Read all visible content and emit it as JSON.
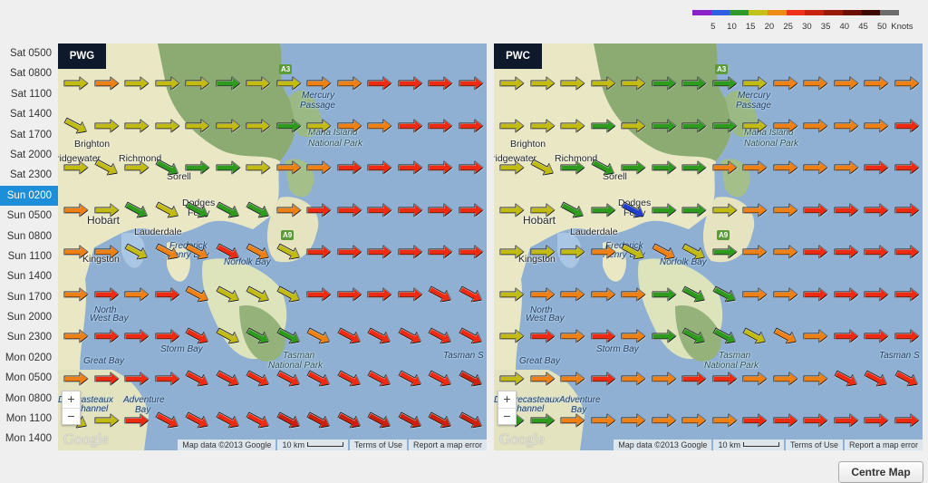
{
  "legend": {
    "colors": [
      "#8b1fc9",
      "#2f5fe0",
      "#2f9a2a",
      "#c4c21a",
      "#ee8a16",
      "#f0301a",
      "#c9220e",
      "#9a1a08",
      "#6e0d04",
      "#3e0602",
      "#6b6b6b"
    ],
    "labels": [
      "5",
      "10",
      "15",
      "20",
      "25",
      "30",
      "35",
      "40",
      "45",
      "50"
    ],
    "units": "Knots"
  },
  "times": {
    "items": [
      "Sat 0500",
      "Sat 0800",
      "Sat 1100",
      "Sat 1400",
      "Sat 1700",
      "Sat 2000",
      "Sat 2300",
      "Sun 0200",
      "Sun 0500",
      "Sun 0800",
      "Sun 1100",
      "Sun 1400",
      "Sun 1700",
      "Sun 2000",
      "Sun 2300",
      "Mon 0200",
      "Mon 0500",
      "Mon 0800",
      "Mon 1100",
      "Mon 1400"
    ],
    "selected_index": 7
  },
  "maps": [
    {
      "label": "PWG",
      "arrow_rows": [
        [
          "Y",
          "O",
          "Y",
          "Y",
          "Y",
          "G",
          "Y",
          "Y",
          "O",
          "O",
          "R",
          "R",
          "R",
          "R"
        ],
        [
          "Y",
          "Y",
          "Y",
          "Y",
          "Y",
          "Y",
          "Y",
          "G",
          "Y",
          "O",
          "O",
          "R",
          "R",
          "R"
        ],
        [
          "Y",
          "Y",
          "Y",
          "G",
          "G",
          "G",
          "Y",
          "O",
          "O",
          "R",
          "R",
          "R",
          "R",
          "R"
        ],
        [
          "O",
          "Y",
          "G",
          "Y",
          "G",
          "G",
          "G",
          "O",
          "R",
          "R",
          "R",
          "R",
          "R",
          "R"
        ],
        [
          "O",
          "O",
          "Y",
          "O",
          "O",
          "R",
          "O",
          "Y",
          "R",
          "R",
          "R",
          "R",
          "R",
          "R"
        ],
        [
          "O",
          "R",
          "O",
          "R",
          "O",
          "Y",
          "Y",
          "Y",
          "R",
          "R",
          "R",
          "R",
          "R",
          "R"
        ],
        [
          "O",
          "R",
          "R",
          "R",
          "R",
          "Y",
          "G",
          "G",
          "O",
          "R",
          "R",
          "R",
          "R",
          "R"
        ],
        [
          "O",
          "R",
          "R",
          "R",
          "R",
          "R",
          "R",
          "R",
          "R",
          "R",
          "R",
          "R",
          "R",
          "D"
        ],
        [
          "Y",
          "Y",
          "R",
          "R",
          "R",
          "R",
          "R",
          "D",
          "D",
          "D",
          "D",
          "D",
          "D",
          "D"
        ]
      ],
      "arrow_dirs": [
        [
          "e",
          "e",
          "e",
          "e",
          "e",
          "e",
          "e",
          "e",
          "e",
          "e",
          "e",
          "e",
          "e",
          "e"
        ],
        [
          "se",
          "e",
          "e",
          "e",
          "e",
          "e",
          "e",
          "e",
          "e",
          "e",
          "e",
          "e",
          "e",
          "e"
        ],
        [
          "e",
          "se",
          "e",
          "se",
          "e",
          "e",
          "e",
          "e",
          "e",
          "e",
          "e",
          "e",
          "e",
          "e"
        ],
        [
          "e",
          "e",
          "se",
          "se",
          "se",
          "se",
          "se",
          "e",
          "e",
          "e",
          "e",
          "e",
          "e",
          "e"
        ],
        [
          "e",
          "e",
          "se",
          "se",
          "se",
          "se",
          "se",
          "se",
          "e",
          "e",
          "e",
          "e",
          "e",
          "e"
        ],
        [
          "e",
          "e",
          "e",
          "e",
          "se",
          "se",
          "se",
          "se",
          "e",
          "e",
          "e",
          "e",
          "se",
          "se"
        ],
        [
          "e",
          "e",
          "e",
          "e",
          "se",
          "se",
          "se",
          "se",
          "se",
          "se",
          "se",
          "se",
          "se",
          "se"
        ],
        [
          "e",
          "e",
          "e",
          "e",
          "se",
          "se",
          "se",
          "se",
          "se",
          "se",
          "se",
          "se",
          "se",
          "se"
        ],
        [
          "se",
          "e",
          "e",
          "se",
          "se",
          "se",
          "se",
          "se",
          "se",
          "se",
          "se",
          "se",
          "se",
          "se"
        ]
      ]
    },
    {
      "label": "PWC",
      "arrow_rows": [
        [
          "Y",
          "Y",
          "Y",
          "Y",
          "Y",
          "G",
          "G",
          "G",
          "Y",
          "O",
          "O",
          "O",
          "O",
          "O"
        ],
        [
          "Y",
          "Y",
          "Y",
          "G",
          "Y",
          "G",
          "G",
          "G",
          "Y",
          "O",
          "O",
          "O",
          "O",
          "R"
        ],
        [
          "Y",
          "Y",
          "G",
          "G",
          "G",
          "G",
          "G",
          "O",
          "O",
          "O",
          "O",
          "O",
          "R",
          "R"
        ],
        [
          "Y",
          "Y",
          "G",
          "G",
          "B",
          "G",
          "G",
          "Y",
          "O",
          "O",
          "R",
          "R",
          "R",
          "R"
        ],
        [
          "Y",
          "Y",
          "Y",
          "O",
          "Y",
          "O",
          "Y",
          "G",
          "O",
          "O",
          "R",
          "R",
          "R",
          "R"
        ],
        [
          "Y",
          "O",
          "O",
          "O",
          "O",
          "G",
          "G",
          "G",
          "O",
          "O",
          "R",
          "R",
          "R",
          "R"
        ],
        [
          "Y",
          "R",
          "O",
          "R",
          "O",
          "G",
          "G",
          "G",
          "Y",
          "O",
          "O",
          "R",
          "R",
          "R"
        ],
        [
          "Y",
          "O",
          "O",
          "R",
          "O",
          "O",
          "R",
          "R",
          "O",
          "O",
          "O",
          "R",
          "R",
          "R"
        ],
        [
          "G",
          "G",
          "O",
          "O",
          "O",
          "O",
          "O",
          "O",
          "R",
          "R",
          "R",
          "R",
          "R",
          "R"
        ]
      ],
      "arrow_dirs": [
        [
          "e",
          "e",
          "e",
          "e",
          "e",
          "e",
          "e",
          "e",
          "e",
          "e",
          "e",
          "e",
          "e",
          "e"
        ],
        [
          "e",
          "e",
          "e",
          "e",
          "e",
          "e",
          "e",
          "e",
          "e",
          "e",
          "e",
          "e",
          "e",
          "e"
        ],
        [
          "e",
          "se",
          "e",
          "se",
          "e",
          "e",
          "e",
          "e",
          "e",
          "e",
          "e",
          "e",
          "e",
          "e"
        ],
        [
          "e",
          "e",
          "se",
          "e",
          "se",
          "e",
          "e",
          "e",
          "e",
          "e",
          "e",
          "e",
          "e",
          "e"
        ],
        [
          "e",
          "e",
          "e",
          "e",
          "se",
          "se",
          "se",
          "e",
          "e",
          "e",
          "e",
          "e",
          "e",
          "e"
        ],
        [
          "e",
          "e",
          "e",
          "e",
          "e",
          "e",
          "se",
          "se",
          "e",
          "e",
          "e",
          "e",
          "e",
          "e"
        ],
        [
          "e",
          "e",
          "e",
          "e",
          "e",
          "e",
          "se",
          "se",
          "se",
          "se",
          "e",
          "e",
          "e",
          "e"
        ],
        [
          "e",
          "e",
          "e",
          "e",
          "e",
          "e",
          "e",
          "e",
          "e",
          "e",
          "e",
          "se",
          "se",
          "se"
        ],
        [
          "e",
          "e",
          "e",
          "e",
          "e",
          "e",
          "e",
          "e",
          "e",
          "e",
          "e",
          "e",
          "e",
          "e"
        ]
      ]
    }
  ],
  "arrow_colors": {
    "B": "#1f3fd0",
    "G": "#2e9a1e",
    "Y": "#c2bc12",
    "O": "#ee8014",
    "R": "#ee2a12",
    "D": "#cc200e"
  },
  "places": {
    "brighton": "Brighton",
    "bridgewater": "ridgewater",
    "richmond": "Richmond",
    "sorell": "Sorell",
    "dodges": "Dodges",
    "ferry": "Ferry",
    "hobart": "Hobart",
    "lauderdale": "Lauderdale",
    "frederick1": "Frederick",
    "frederick2": "Henry Bay",
    "kingston": "Kingston",
    "norfolk": "Norfolk Bay",
    "north_west_bay1": "North",
    "north_west_bay2": "West Bay",
    "storm_bay": "Storm Bay",
    "great_bay": "Great Bay",
    "tasman_np1": "Tasman",
    "tasman_np2": "National Park",
    "tasman_sea": "Tasman S",
    "dentre_left1": "D'  recasteaux",
    "dentre_right1": "D'entrecasteaux",
    "channel": "Channel",
    "adventure1": "Adventure",
    "adventure2": "Bay",
    "mercury1": "Mercury",
    "mercury2": "Passage",
    "maria1": "Maria Island",
    "maria2": "National Park",
    "road_a3": "A3",
    "road_a9": "A9"
  },
  "map_footer": {
    "attribution": "Map data ©2013 Google",
    "scale": "10 km",
    "terms": "Terms of Use",
    "report": "Report a map error"
  },
  "google_logo": "Google",
  "zoom_in": "+",
  "zoom_out": "−",
  "centre_button": "Centre Map"
}
